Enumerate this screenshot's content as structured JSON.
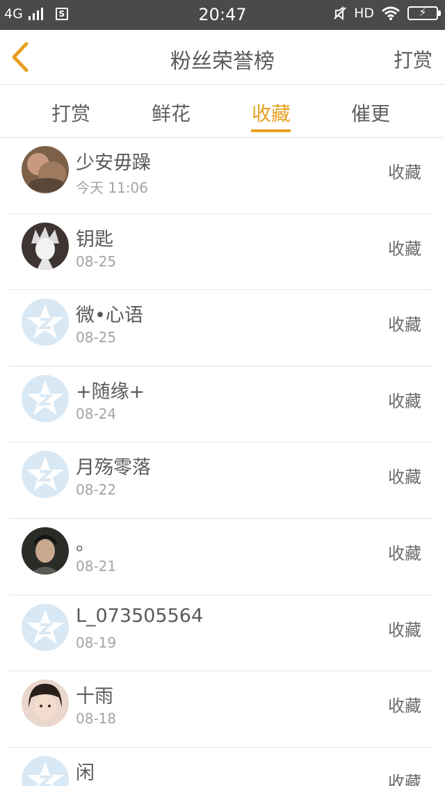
{
  "status_bar": {
    "network": "4G",
    "time": "20:47",
    "hd": "HD"
  },
  "header": {
    "title": "粉丝荣誉榜",
    "right_action": "打赏"
  },
  "tabs": [
    {
      "label": "打赏",
      "active": false
    },
    {
      "label": "鲜花",
      "active": false
    },
    {
      "label": "收藏",
      "active": true
    },
    {
      "label": "催更",
      "active": false
    }
  ],
  "accent_color": "#e8a020",
  "fans": [
    {
      "name": "少安毋躁",
      "date": "今天 11:06",
      "action": "收藏",
      "avatar": "photo-1"
    },
    {
      "name": "钥匙",
      "date": "08-25",
      "action": "收藏",
      "avatar": "sketch-avatar"
    },
    {
      "name": "微•心语",
      "date": "08-25",
      "action": "收藏",
      "avatar": "default-star-avatar"
    },
    {
      "name": "+随缘+",
      "date": "08-24",
      "action": "收藏",
      "avatar": "default-star-avatar"
    },
    {
      "name": "月殇零落",
      "date": "08-22",
      "action": "收藏",
      "avatar": "default-star-avatar"
    },
    {
      "name": "。",
      "date": "08-21",
      "action": "收藏",
      "avatar": "photo-2"
    },
    {
      "name": "L_073505564",
      "date": "08-19",
      "action": "收藏",
      "avatar": "default-star-avatar"
    },
    {
      "name": "十雨",
      "date": "08-18",
      "action": "收藏",
      "avatar": "photo-3"
    },
    {
      "name": "闲",
      "date": "",
      "action": "收藏",
      "avatar": "default-star-avatar"
    }
  ]
}
